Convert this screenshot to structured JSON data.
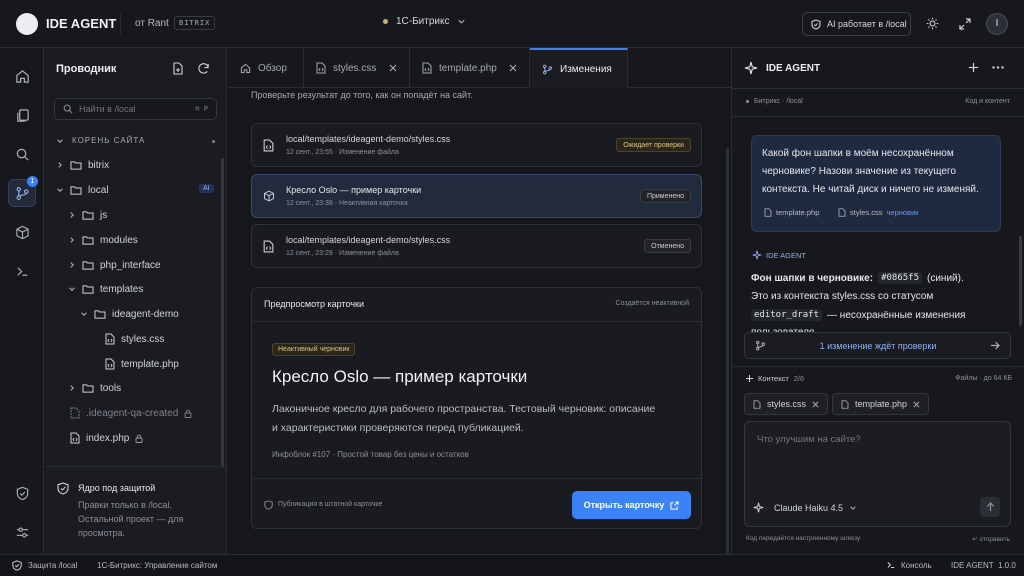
{
  "top": {
    "brand": "IDE AGENT",
    "author": "от Rant",
    "edition": "BITRIX",
    "project": "1С-Битрикс",
    "ai_status": "AI работает в /local",
    "user_initial": "I"
  },
  "explorer": {
    "title": "Проводник",
    "search_placeholder": "Найти в /local",
    "search_shortcut": "⌘ P",
    "root_label": "КОРЕНЬ САЙТА",
    "items": [
      {
        "name": "bitrix"
      },
      {
        "name": "local",
        "badge": "AI"
      },
      {
        "name": "js"
      },
      {
        "name": "modules"
      },
      {
        "name": "php_interface"
      },
      {
        "name": "templates"
      },
      {
        "name": "ideagent-demo"
      },
      {
        "name": "styles.css"
      },
      {
        "name": "template.php"
      },
      {
        "name": "tools"
      },
      {
        "name": ".ideagent-qa-created"
      },
      {
        "name": "index.php"
      }
    ],
    "protect_title": "Ядро под защитой",
    "protect_text_1": "Правки только в /local.",
    "protect_text_2": "Остальной проект — для",
    "protect_text_3": "просмотра."
  },
  "tabs": [
    {
      "label": "Обзор"
    },
    {
      "label": "styles.css"
    },
    {
      "label": "template.php"
    },
    {
      "label": "Изменения"
    }
  ],
  "changes": {
    "intro": "Проверьте результат до того, как он попадёт на сайт.",
    "items": [
      {
        "title": "local/templates/ideagent-demo/styles.css",
        "meta": "12 сент., 23:55 · Изменение файла",
        "status": "Ожидает проверки"
      },
      {
        "title": "Кресло Oslo — пример карточки",
        "meta": "12 сент., 23:38 · Неактивная карточка",
        "status": "Применено"
      },
      {
        "title": "local/templates/ideagent-demo/styles.css",
        "meta": "12 сент., 23:29 · Изменение файла",
        "status": "Отменено"
      }
    ],
    "preview_title": "Предпросмотр карточки",
    "preview_note": "Создаётся неактивной",
    "draft_badge": "Неактивный черновик",
    "product_title": "Кресло Oslo — пример карточки",
    "product_desc_1": "Лаконичное кресло для рабочего пространства. Тестовый черновик: описание",
    "product_desc_2": "и характеристики проверяются перед публикацией.",
    "product_meta": "Инфоблок #107 · Простой товар без цены и остатков",
    "publish_note": "Публикация в штатной карточке",
    "open_button": "Открыть карточку"
  },
  "agent": {
    "title": "IDE AGENT",
    "context_path": "Битрикс · /local",
    "mode": "Код и контент",
    "user_message_1": "Какой фон шапки в моём несохранённом",
    "user_message_2": "черновике? Назови значение из текущего",
    "user_message_3": "контекста. Не читай диск и ничего не изменяй.",
    "attach_1": "template.php",
    "attach_2": "styles.css",
    "attach_2_tag": "черновик",
    "reply_label": "IDE AGENT",
    "reply_1_bold": "Фон шапки в черновике:",
    "reply_1_code": "#0865f5",
    "reply_1_end": "(синий).",
    "reply_2": "Это из контекста styles.css со статусом",
    "reply_3_code": "editor_draft",
    "reply_3_end": "— несохранённые изменения",
    "reply_4": "пользователя.",
    "pending": "1 изменение ждёт проверки",
    "context_label": "Контекст",
    "context_count": "2/6",
    "files_limit": "Файлы · до 64 КБ",
    "chip_1": "styles.css",
    "chip_2": "template.php",
    "input_placeholder": "Что улучшим на сайте?",
    "model": "Claude Haiku 4.5",
    "footer_note": "Код передаётся настроенному шлюзу",
    "send_hint": "↵ отправить"
  },
  "statusbar": {
    "protect": "Защита /local",
    "project": "1С-Битрикс: Управление сайтом",
    "console": "Консоль",
    "version": "IDE AGENT  1.0.0"
  },
  "colors": {
    "accent": "#3b82f6",
    "bg": "#17181c",
    "panel": "#1b1c21"
  }
}
